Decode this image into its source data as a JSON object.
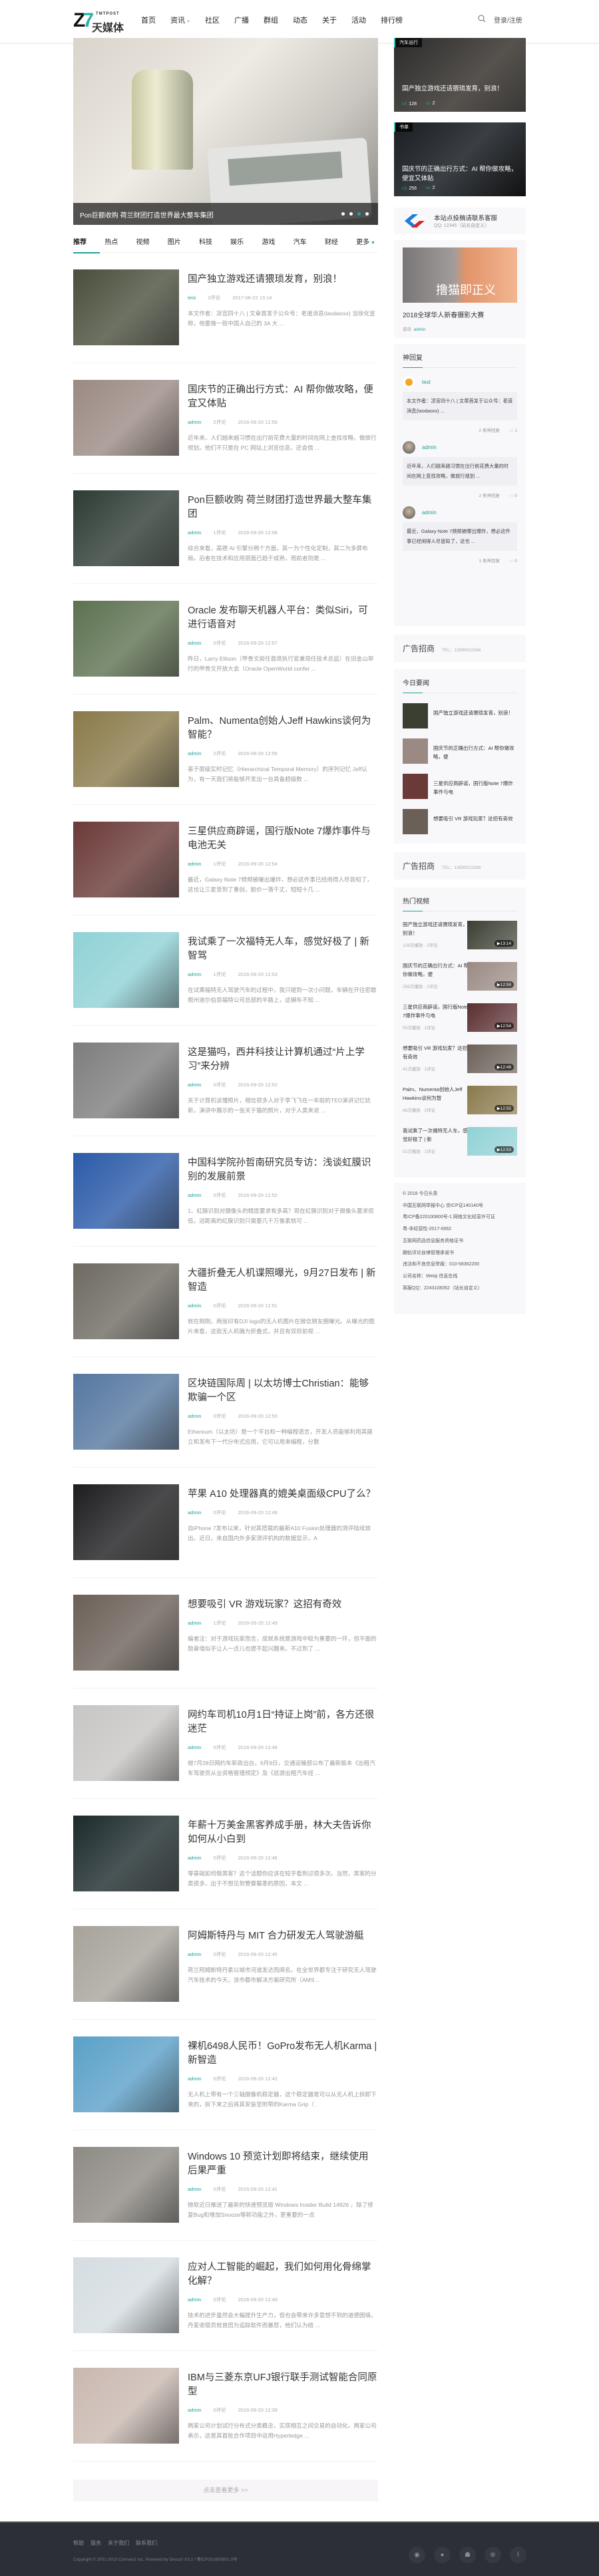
{
  "header": {
    "logo_en": "TMTPOST",
    "logo_cn": "天媒体",
    "nav": [
      "首页",
      "资讯",
      "社区",
      "广播",
      "群组",
      "动态",
      "关于",
      "活动",
      "排行榜"
    ],
    "active_nav": 0,
    "login": "登录/注册"
  },
  "hero": {
    "caption": "Pon巨额收购 荷兰财团打造世界最大整车集团",
    "slides": 4,
    "active_slide": 2
  },
  "tabs": {
    "items": [
      "推荐",
      "热点",
      "视频",
      "图片",
      "科技",
      "娱乐",
      "游戏",
      "汽车",
      "财经"
    ],
    "more": "更多"
  },
  "articles": [
    {
      "title": "国产独立游戏还请猥琐发育，别浪！",
      "author": "test",
      "comments": "2评论",
      "date": "2017-06-22 13:14",
      "excerpt": "本文作者：凉宫四十八 | 文章首发于公众号：老道消息(laodaoxx) 当徐化宣称，他要做一款中国人自己的 3A 大 ...",
      "color": "#4a4f3c"
    },
    {
      "title": "国庆节的正确出行方式：AI 帮你做攻略，便宜又体贴",
      "author": "admin",
      "comments": "2评论",
      "date": "2016-09-20 12:59",
      "excerpt": "近年来，人们越来越习惯在出行前花费大量的时间在网上查找攻略，做旅行规划。他们不只是在 PC 网站上浏览信息，还会借 ...",
      "color": "#9b8a83"
    },
    {
      "title": "Pon巨额收购 荷兰财团打造世界最大整车集团",
      "author": "admin",
      "comments": "1评论",
      "date": "2016-09-20 12:58",
      "excerpt": "综合来看，高德 AI 引擎分两个方面，其一为个性化定制，其二为多屏布局。后者在技术和应用层面已趋于成熟，而前者则是 ...",
      "color": "#2d3b33"
    },
    {
      "title": "Oracle 发布聊天机器人平台：类似Siri，可进行语音对",
      "author": "admin",
      "comments": "0评论",
      "date": "2016-09-20 12:57",
      "excerpt": "昨日，Larry Ellison（甲骨文前任首席执行官兼现任技术总监）在旧金山举行的甲骨文开放大会（Oracle OpenWorld confer ...",
      "color": "#5d7150"
    },
    {
      "title": "Palm、Numenta创始人Jeff Hawkins谈何为智能？",
      "author": "admin",
      "comments": "2评论",
      "date": "2016-09-20 12:55",
      "excerpt": "基于层级实时记忆（Hierarchical Temporal Memory）的序列记忆 Jeff认为，有一天我们将能够开发出一台具备超级数 ...",
      "color": "#8a7a4a"
    },
    {
      "title": "三星供应商辟谣，国行版Note 7爆炸事件与电池无关",
      "author": "admin",
      "comments": "1评论",
      "date": "2016-09-20 12:54",
      "excerpt": "最近，Galaxy Note 7频频被曝出爆炸，想必这件事已经闹得人尽皆知了，这也让三星受到了重创，股价一落千丈，短短十几 ...",
      "color": "#6a3a38"
    },
    {
      "title": "我试乘了一次福特无人车，感觉好极了 | 新智驾",
      "author": "admin",
      "comments": "1评论",
      "date": "2016-09-20 12:53",
      "excerpt": "在试乘福特无人驾驶汽车的过程中，我只碰到一次小问题，车辆在开往密歇根州迪尔伯恩福特公司总部的半路上，这辆车不知 ...",
      "color": "#8fd2d6"
    },
    {
      "title": "这是猫吗，西井科技让计算机通过“片上学习”来分辨",
      "author": "admin",
      "comments": "0评论",
      "date": "2016-09-20 12:52",
      "excerpt": "关于计算机读懂照片，相信很多人对于李飞飞在一年前的TED演讲记忆犹新，演讲中展示的一张关于猫的照片，对于人类来说 ...",
      "color": "#7d7d7d"
    },
    {
      "title": "中国科学院孙哲南研究员专访：浅谈虹膜识别的发展前景",
      "author": "admin",
      "comments": "0评论",
      "date": "2016-09-20 12:52",
      "excerpt": "1、虹膜识别对摄像头的精度要求有多高？现在虹膜识别对于摄像头要求很低，远距离的虹膜识别只需要几千万像素就可 ...",
      "color": "#2a5aa8"
    },
    {
      "title": "大疆折叠无人机谍照曝光，9月27日发布 | 新智造",
      "author": "admin",
      "comments": "0评论",
      "date": "2016-09-20 12:51",
      "excerpt": "就在刚刚，两张印有DJI logo的无人机图片在微信朋友圈曝光。从曝光的图片来看，这款无人机确为折叠式，并且有双目前视 ...",
      "color": "#6e6a62"
    },
    {
      "title": "区块链国际周 | 以太坊博士Christian：能够欺骗一个区",
      "author": "admin",
      "comments": "0评论",
      "date": "2016-09-20 12:50",
      "excerpt": "Ethereum（以太坊）是一个平台和一种编程语言，开发人员能够利用其建立和发布下一代分布式应用，它可以用来编程，分散",
      "color": "#5577a0"
    },
    {
      "title": "苹果 A10 处理器真的媲美桌面级CPU了么？",
      "author": "admin",
      "comments": "0评论",
      "date": "2016-09-20 12:49",
      "excerpt": "自iPhone 7发布以来，针对其搭载的最新A10 Fusion处理器的测评陆续放出。近日，来自国内外多家测评机构的数据显示，A",
      "color": "#1d1d1f"
    },
    {
      "title": "想要吸引 VR 游戏玩家？这招有奇效",
      "author": "admin",
      "comments": "1评论",
      "date": "2016-09-20 12:49",
      "excerpt": "编者注：对于游戏玩家而言，成就系统是游戏中较为重要的一环，但平面的勋章墙似乎让人一点儿也提不起兴趣来。不过到了 ...",
      "color": "#6b6058"
    },
    {
      "title": "网约车司机10月1日“持证上岗”前，各方还很迷茫",
      "author": "admin",
      "comments": "0评论",
      "date": "2016-09-20 12:46",
      "excerpt": "继7月28日网约车新政出台，9月9日，交通运输部公布了最新版本《出租汽车驾驶员从业资格管理规定》及《巡游出租汽车经 ...",
      "color": "#c8c6c4"
    },
    {
      "title": "年薪十万美金黑客养成手册，林大夫告诉你如何从小白到",
      "author": "admin",
      "comments": "0评论",
      "date": "2016-09-20 12:46",
      "excerpt": "零基础如何做黑客？这个话题你应该在知乎看到过很多次。当然，黑客的分类很多，出于不想见到警察蜀黍的原因，本文 ...",
      "color": "#1c2a2c"
    },
    {
      "title": "阿姆斯特丹与 MIT 合力研发无人驾驶游艇",
      "author": "admin",
      "comments": "0评论",
      "date": "2016-09-20 12:45",
      "excerpt": "荷兰阿姆斯特丹素以城市河道发达而闻名。在全世界都专注于研究无人驾驶汽车技术的今天，该市都市解决方案研究所（AMS ..",
      "color": "#a7a39b"
    },
    {
      "title": "裸机6498人民币！GoPro发布无人机Karma | 新智造",
      "author": "admin",
      "comments": "0评论",
      "date": "2016-09-20 12:42",
      "excerpt": "无人机上带有一个三轴摄像机稳定器，这个稳定器是可以从无人机上拆卸下来的，拆下来之后将其安装至附带的Karma Grip（ .",
      "color": "#5aa0c8"
    },
    {
      "title": "Windows 10 预览计划即将结束，继续使用后果严重",
      "author": "admin",
      "comments": "0评论",
      "date": "2016-09-20 12:41",
      "excerpt": "微软近日推送了最新的快速预览版 Windows Insider Build 14926 ，除了修复Bug和增加Snooze等新功能之外，更重要的一点",
      "color": "#8e8a84"
    },
    {
      "title": "应对人工智能的崛起，我们如何用化骨绵掌化解？",
      "author": "admin",
      "comments": "0评论",
      "date": "2016-09-20 12:40",
      "excerpt": "技术的进步虽然会大幅提升生产力，但也会带来许多意想不到的道德困境。丹麦收银员就曾因为追踪软件而暴怒，他们认为结 ...",
      "color": "#d5dde2"
    },
    {
      "title": "IBM与三菱东京UFJ银行联手测试智能合同原型",
      "author": "admin",
      "comments": "0评论",
      "date": "2016-09-20 12:39",
      "excerpt": "两家公司计划试行分布式分类概念，实现相互之间交易的自动化。两家公司表示，这是其首批合作项目中运用Hyperledge ...",
      "color": "#c9b8b0"
    }
  ],
  "load_more": "点击查看更多 >>",
  "sidebar": {
    "featured": [
      {
        "tag": "汽车出行",
        "title": "国产独立游戏还请猥琐发育，别浪！",
        "likes": "128",
        "comments": "2"
      },
      {
        "tag": "书单",
        "title": "国庆节的正确出行方式：AI 帮你做攻略，便宜又体贴",
        "likes": "256",
        "comments": "2"
      }
    ],
    "qq": {
      "line1": "本站点投稿请联系客服",
      "line2": "QQ: 12345（站长自定义）"
    },
    "promo": {
      "image_text": "撸猫即正义",
      "title": "2018全球华人新春摄影大赛",
      "category": "资讯",
      "author": "admin"
    },
    "replies": {
      "title": "神回复",
      "items": [
        {
          "user": "test",
          "text": "本文作者：凉宫四十八 | 文章首发于公众号：老道消息(laodaoxx) ...",
          "count": "2 条神回复",
          "likes": "1"
        },
        {
          "user": "admin",
          "text": "近年来，人们越来越习惯在出行前花费大量的时间在网上查找攻略，做旅行规划 ...",
          "count": "2 条神回复",
          "likes": "0"
        },
        {
          "user": "admin",
          "text": "最近，Galaxy Note 7频频被曝出爆炸，想必这件事已经闹得人尽皆知了，这也 ...",
          "count": "1 条神回复",
          "likes": "0"
        }
      ]
    },
    "ad": {
      "title": "广告招商",
      "tel": "TEL：13590022288"
    },
    "news": {
      "title": "今日要闻",
      "items": [
        "国产独立游戏还请猥琐发育，别浪！",
        "国庆节的正确出行方式：AI 帮你做攻略，便",
        "三星供应商辟谣，国行版Note 7爆炸事件与电",
        "想要吸引 VR 游戏玩家？这招有奇效"
      ]
    },
    "videos": {
      "title": "热门视频",
      "items": [
        {
          "title": "国产独立游戏还请猥琐发育，别浪！",
          "meta": "128次播放 · 2评论",
          "duration": "▶13:14",
          "color": "#3b3f32"
        },
        {
          "title": "国庆节的正确出行方式：AI 帮你做攻略，便",
          "meta": "256次播放 · 2评论",
          "duration": "▶12:59",
          "color": "#9b8a83"
        },
        {
          "title": "三星供应商辟谣，国行版Note 7爆炸事件与电",
          "meta": "50次播放 · 1评论",
          "duration": "▶12:54",
          "color": "#5a2e30"
        },
        {
          "title": "想要吸引 VR 游戏玩家？这招有奇效",
          "meta": "41次播放 · 1评论",
          "duration": "▶12:49",
          "color": "#6b6058"
        },
        {
          "title": "Palm、Numenta创始人Jeff Hawkins谈何为智",
          "meta": "86次播放 · 2评论",
          "duration": "▶12:55",
          "color": "#8a7a4a"
        },
        {
          "title": "我试乘了一次福特无人车，感觉好极了 | 新",
          "meta": "52次播放 · 1评论",
          "duration": "▶12:53",
          "color": "#8fd2d6"
        }
      ]
    },
    "copyright": [
      "© 2018 今日头条",
      "中国互联网举报中心 京ICP证140140号",
      "粤ICP备220100800号-1 网络文化经营许可证",
      "粤-非经营性-2017-0062",
      "互联网药品信息服务资格证书",
      "跟帖评论自律管理承诺书",
      "违法和不良信息举报：010-58362200",
      "公司名称：Weiqi 信息在线",
      "客服QQ：2243108352（站长自定义）"
    ]
  },
  "footer": {
    "links": [
      "帮助",
      "服务",
      "关于我们",
      "联系我们"
    ],
    "copyright": "Copyright © 2001-2013 Comsenz Inc. Powered by Discuz! X3.2 / 粤ICP201600801-3号",
    "icons": [
      "wechat-icon",
      "apple-icon",
      "android-icon",
      "dribbble-icon",
      "rss-icon"
    ]
  },
  "colors": {
    "accent": "#1fa39a",
    "footer_bg": "#2d2f36"
  }
}
